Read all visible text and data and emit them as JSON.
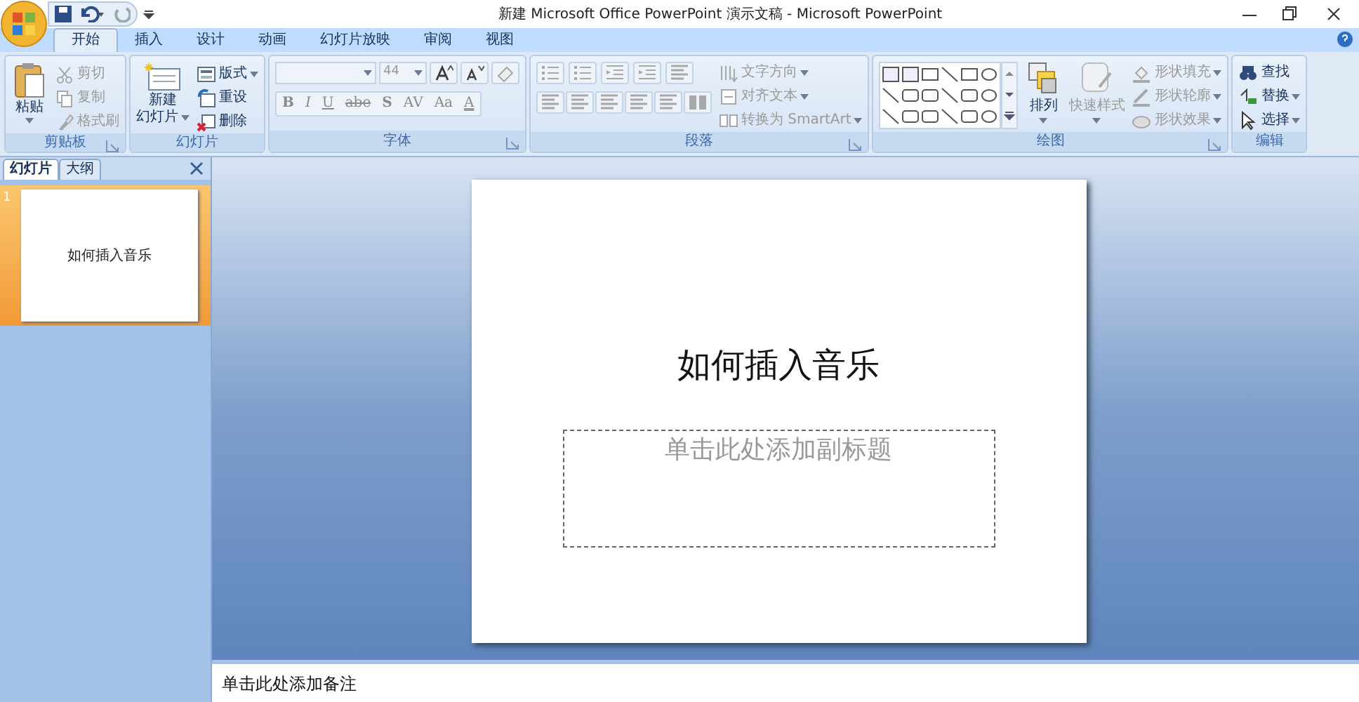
{
  "window": {
    "title": "新建 Microsoft Office PowerPoint 演示文稿 - Microsoft PowerPoint"
  },
  "tabs": [
    {
      "label": "开始",
      "selected": true
    },
    {
      "label": "插入",
      "selected": false
    },
    {
      "label": "设计",
      "selected": false
    },
    {
      "label": "动画",
      "selected": false
    },
    {
      "label": "幻灯片放映",
      "selected": false
    },
    {
      "label": "审阅",
      "selected": false
    },
    {
      "label": "视图",
      "selected": false
    }
  ],
  "ribbon": {
    "clipboard": {
      "label": "剪贴板",
      "paste": {
        "label": "粘贴",
        "disabled": false
      },
      "items": [
        {
          "label": "剪切",
          "dropdown": false,
          "disabled": true
        },
        {
          "label": "复制",
          "dropdown": false,
          "disabled": true
        },
        {
          "label": "格式刷",
          "dropdown": false,
          "disabled": true
        }
      ]
    },
    "slides": {
      "label": "幻灯片",
      "new_slide": {
        "lines": [
          "新建",
          "幻灯片"
        ],
        "disabled": false
      },
      "items": [
        {
          "label": "版式",
          "dropdown": true,
          "disabled": false
        },
        {
          "label": "重设",
          "dropdown": false,
          "disabled": false
        },
        {
          "label": "删除",
          "dropdown": false,
          "disabled": false
        }
      ]
    },
    "font": {
      "label": "字体",
      "size": "44",
      "disabled": true,
      "glyphs": [
        {
          "text": "B",
          "kind": "bold"
        },
        {
          "text": "I",
          "kind": "italic"
        },
        {
          "text": "U",
          "kind": "underline"
        },
        {
          "text": "abe",
          "kind": "strike"
        },
        {
          "text": "S",
          "kind": "shadow"
        },
        {
          "text": "AV",
          "kind": "spacing"
        },
        {
          "text": "Aa",
          "kind": "case"
        },
        {
          "text": "A",
          "kind": "color"
        }
      ]
    },
    "paragraph": {
      "label": "段落",
      "commands": [
        {
          "label": "文字方向",
          "dropdown": true,
          "disabled": true
        },
        {
          "label": "对齐文本",
          "dropdown": true,
          "disabled": true
        },
        {
          "label": "转换为 SmartArt",
          "dropdown": true,
          "disabled": true
        }
      ]
    },
    "drawing": {
      "label": "绘图",
      "arrange": {
        "label": "排列",
        "disabled": false
      },
      "quick_styles": {
        "label": "快速样式",
        "disabled": true
      },
      "items": [
        {
          "label": "形状填充",
          "dropdown": true,
          "disabled": true
        },
        {
          "label": "形状轮廓",
          "dropdown": true,
          "disabled": true
        },
        {
          "label": "形状效果",
          "dropdown": true,
          "disabled": true
        }
      ]
    },
    "editing": {
      "label": "编辑",
      "items": [
        {
          "label": "查找",
          "dropdown": false,
          "disabled": false
        },
        {
          "label": "替换",
          "dropdown": true,
          "disabled": false
        },
        {
          "label": "选择",
          "dropdown": true,
          "disabled": false
        }
      ]
    }
  },
  "left_pane": {
    "tabs": [
      {
        "label": "幻灯片",
        "selected": true
      },
      {
        "label": "大纲",
        "selected": false
      }
    ],
    "thumbnails": [
      {
        "number": "1",
        "title": "如何插入音乐",
        "selected": true
      }
    ]
  },
  "slide": {
    "title": "如何插入音乐",
    "subtitle_prompt": "单击此处添加副标题"
  },
  "notes": {
    "prompt": "单击此处添加备注"
  }
}
